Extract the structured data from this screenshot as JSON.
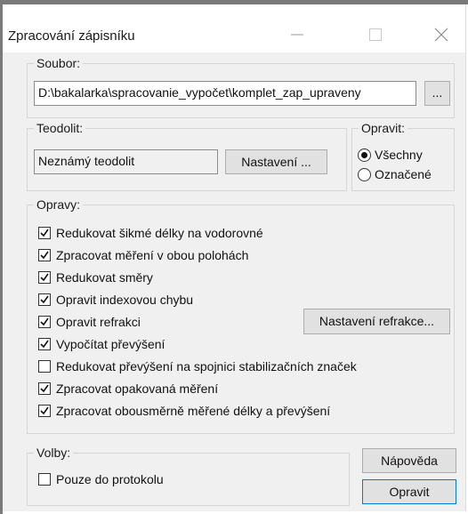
{
  "window": {
    "title": "Zpracování zápisníku",
    "minimize_icon": "minimize-icon",
    "maximize_icon": "maximize-icon",
    "close_icon": "close-icon"
  },
  "soubor": {
    "legend": "Soubor:",
    "path_value": "D:\\bakalarka\\spracovanie_vypočet\\komplet_zap_upraveny",
    "browse_label": "..."
  },
  "teodolit": {
    "legend": "Teodolit:",
    "name_value": "Neznámý teodolit",
    "settings_label": "Nastavení ..."
  },
  "opravit": {
    "legend": "Opravit:",
    "options": [
      {
        "label": "Všechny",
        "selected": true
      },
      {
        "label": "Označené",
        "selected": false
      }
    ]
  },
  "opravy": {
    "legend": "Opravy:",
    "items": [
      {
        "label": "Redukovat šikmé délky na vodorovné",
        "checked": true
      },
      {
        "label": "Zpracovat měření v obou polohách",
        "checked": true
      },
      {
        "label": "Redukovat směry",
        "checked": true
      },
      {
        "label": "Opravit indexovou chybu",
        "checked": true
      },
      {
        "label": "Opravit refrakci",
        "checked": true
      },
      {
        "label": "Vypočítat převýšení",
        "checked": true
      },
      {
        "label": "Redukovat převýšení na spojnici stabilizačních značek",
        "checked": false
      },
      {
        "label": "Zpracovat opakovaná měření",
        "checked": true
      },
      {
        "label": "Zpracovat obousměrně měřené délky a převýšení",
        "checked": true
      }
    ],
    "refraction_settings_label": "Nastavení refrakce..."
  },
  "volby": {
    "legend": "Volby:",
    "items": [
      {
        "label": "Pouze do protokolu",
        "checked": false
      }
    ]
  },
  "actions": {
    "help_label": "Nápověda",
    "apply_label": "Opravit"
  },
  "colors": {
    "dialog_bg": "#f0f0f0",
    "title_bg": "#ffffff",
    "focus_border": "#0078d7"
  }
}
